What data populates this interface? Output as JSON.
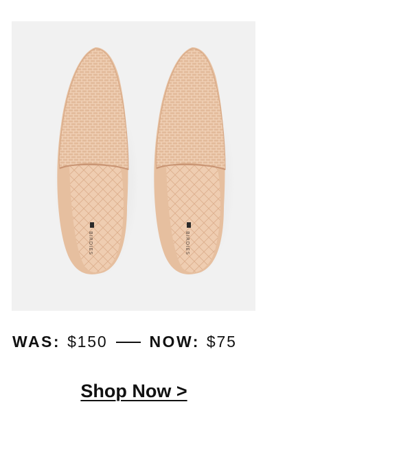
{
  "product": {
    "image_alt": "Woven blush pointed-toe mules, top view",
    "insole_brand": "BIRDIES"
  },
  "pricing": {
    "was_label": "WAS:",
    "was_price": "$150",
    "now_label": "NOW:",
    "now_price": "$75"
  },
  "cta": {
    "shop_now_label": "Shop Now >"
  },
  "colors": {
    "text": "#111111",
    "image_background": "#f1f1f1",
    "shoe_tan": "#e8c3a5"
  }
}
